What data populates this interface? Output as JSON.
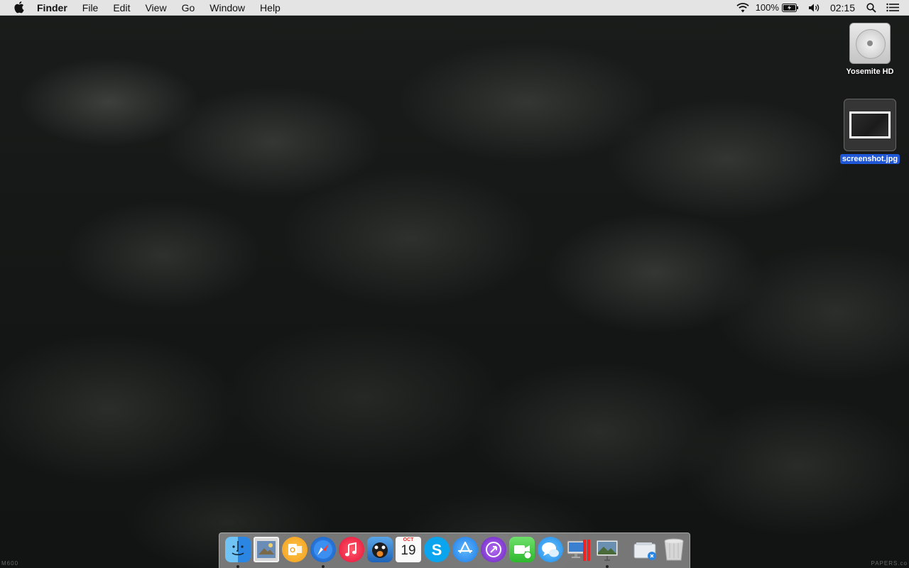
{
  "menubar": {
    "apple_icon": "apple-icon",
    "app_name": "Finder",
    "menus": [
      "File",
      "Edit",
      "View",
      "Go",
      "Window",
      "Help"
    ],
    "status": {
      "battery_percent": "100%",
      "time": "02:15"
    }
  },
  "desktop": {
    "icons": [
      {
        "label": "Yosemite HD",
        "selected": false
      },
      {
        "label": "screenshot.jpg",
        "selected": true
      }
    ],
    "watermark_left": "M600",
    "watermark_right": "PAPERS.co"
  },
  "dock": {
    "items": [
      {
        "name": "Finder",
        "running": true
      },
      {
        "name": "Preview",
        "running": false
      },
      {
        "name": "Outlook",
        "running": false
      },
      {
        "name": "Safari",
        "running": true
      },
      {
        "name": "iTunes",
        "running": false
      },
      {
        "name": "Growl",
        "running": false
      },
      {
        "name": "Calendar",
        "running": false,
        "month": "OCT",
        "day": "19"
      },
      {
        "name": "Skype",
        "running": false
      },
      {
        "name": "App Store",
        "running": false
      },
      {
        "name": "Mixer",
        "running": false
      },
      {
        "name": "FaceTime",
        "running": false
      },
      {
        "name": "Messages",
        "running": false
      },
      {
        "name": "Parallels",
        "running": false
      },
      {
        "name": "Photo Slideshow",
        "running": true
      },
      {
        "name": "Downloads",
        "running": false
      },
      {
        "name": "Trash",
        "running": false
      }
    ]
  }
}
